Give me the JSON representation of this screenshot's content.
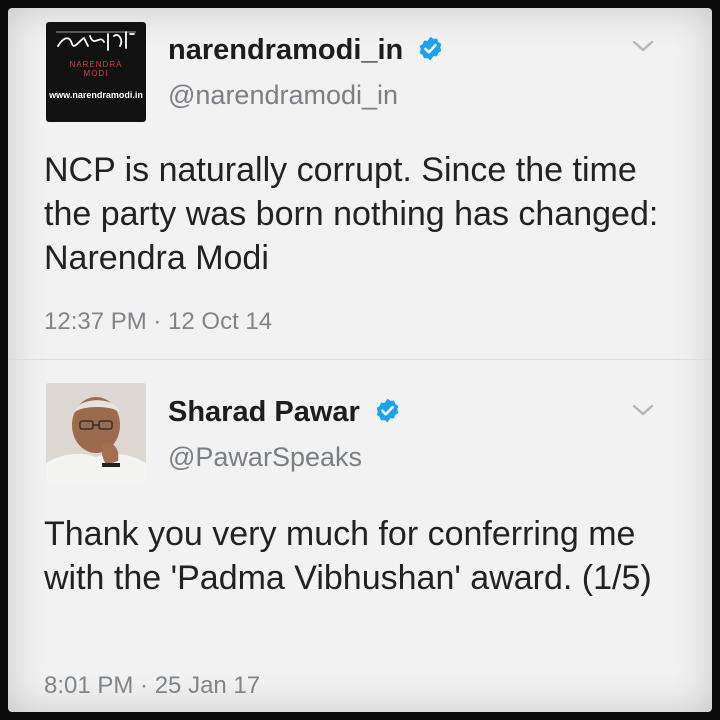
{
  "tweets": [
    {
      "display_name": "narendramodi_in",
      "handle": "@narendramodi_in",
      "text": "NCP is naturally corrupt. Since the time the party was born nothing has changed: Narendra Modi",
      "timestamp": "12:37 PM · 12 Oct 14",
      "avatar": {
        "signature": "नरेन्द्र मोदी",
        "subline": "NARENDRA MODI",
        "url": "www.narendramodi.in"
      }
    },
    {
      "display_name": "Sharad Pawar",
      "handle": "@PawarSpeaks",
      "text": "Thank you very much for conferring me with the 'Padma Vibhushan' award. (1/5)",
      "timestamp": "8:01 PM · 25 Jan 17"
    }
  ],
  "icons": {
    "verified": "verified-badge-icon",
    "menu": "chevron-down-icon"
  },
  "colors": {
    "verified_blue": "#1da1f2",
    "name": "#1d1d1d",
    "handle": "#7a7f85",
    "background": "#f2f2f2"
  }
}
